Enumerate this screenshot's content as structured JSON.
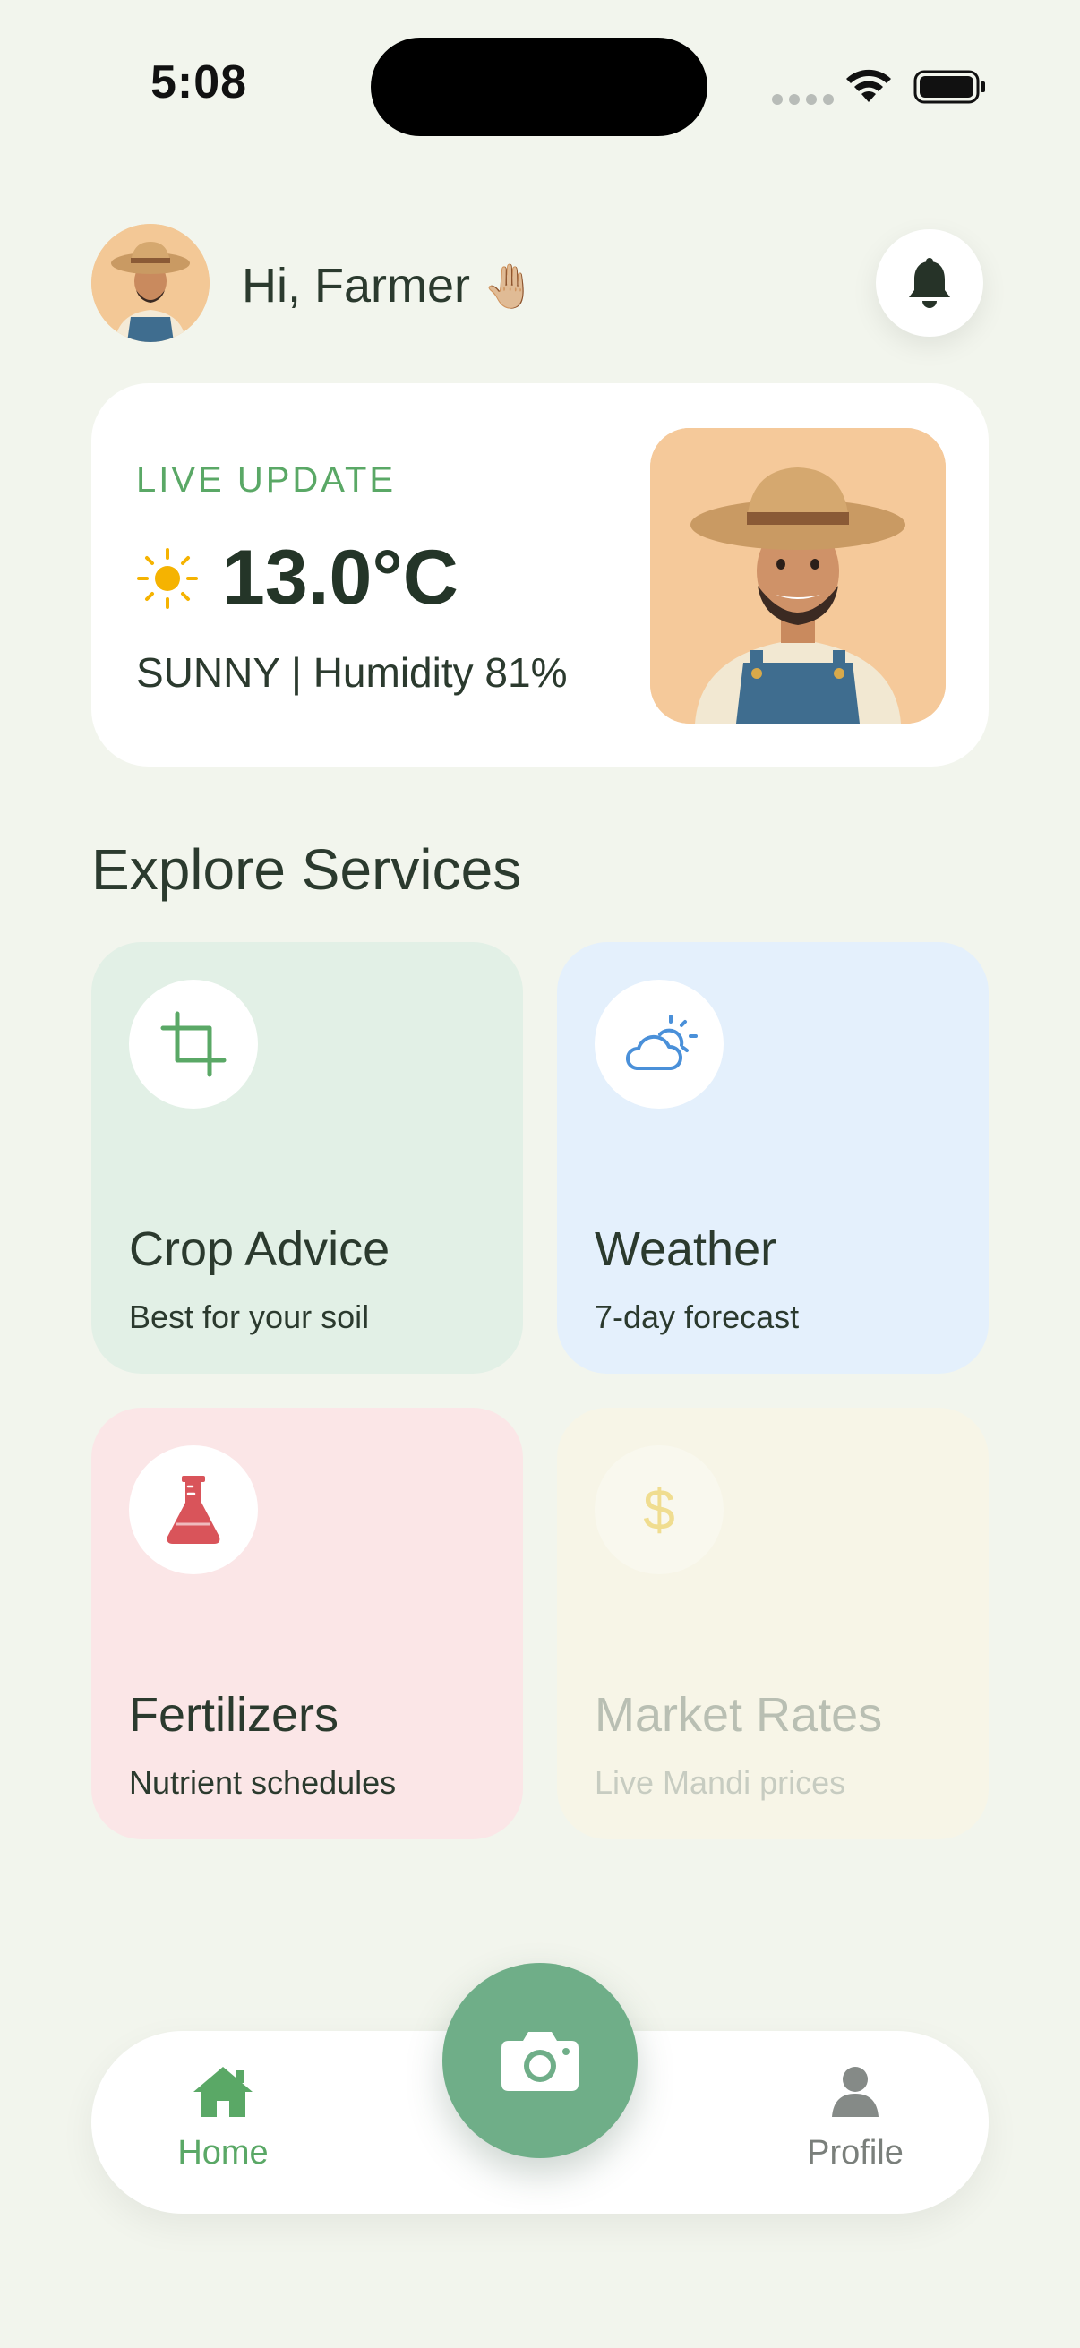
{
  "status_bar": {
    "time": "5:08"
  },
  "header": {
    "greeting": "Hi, Farmer",
    "wave_emoji": "🤚🏼",
    "avatar_icon": "farmer-avatar",
    "notification_icon": "bell-icon"
  },
  "live_update": {
    "label": "LIVE UPDATE",
    "temperature": "13.0°C",
    "condition_line": "SUNNY | Humidity 81%",
    "weather_icon": "sun-icon"
  },
  "services": {
    "title": "Explore Services",
    "items": [
      {
        "title": "Crop Advice",
        "subtitle": "Best for your soil",
        "icon": "crop-icon",
        "bg": "#e2f0e6",
        "accent": "#5aa866"
      },
      {
        "title": "Weather",
        "subtitle": "7-day forecast",
        "icon": "cloud-sun-icon",
        "bg": "#e4f0fc",
        "accent": "#4a90d9"
      },
      {
        "title": "Fertilizers",
        "subtitle": "Nutrient schedules",
        "icon": "flask-icon",
        "bg": "#fbe6e7",
        "accent": "#d9545a"
      },
      {
        "title": "Market Rates",
        "subtitle": "Live Mandi prices",
        "icon": "dollar-icon",
        "symbol": "$",
        "bg": "#f7f5e7",
        "accent": "#f0dd90"
      }
    ]
  },
  "bottom_nav": {
    "home_label": "Home",
    "profile_label": "Profile",
    "camera_icon": "camera-icon",
    "active_color": "#5aa866"
  }
}
